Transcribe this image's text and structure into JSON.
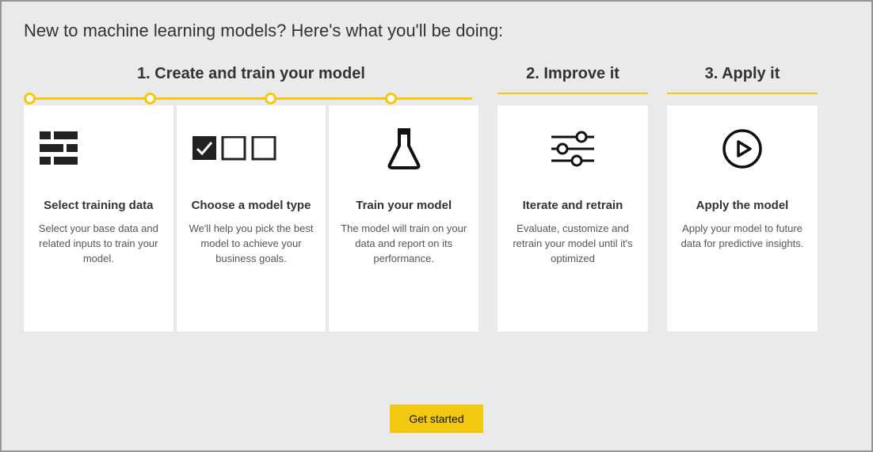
{
  "title": "New to machine learning models? Here's what you'll be doing:",
  "sections": {
    "s1": {
      "title": "1. Create and train your model"
    },
    "s2": {
      "title": "2. Improve it"
    },
    "s3": {
      "title": "3. Apply it"
    }
  },
  "cards": {
    "c1": {
      "title": "Select training data",
      "desc": "Select your base data and related inputs to train your model.",
      "icon": "data-rows-icon"
    },
    "c2": {
      "title": "Choose a model type",
      "desc": "We'll help you pick the best model to achieve your business goals.",
      "icon": "checkbox-options-icon"
    },
    "c3": {
      "title": "Train your model",
      "desc": "The model will train on your data and report on its performance.",
      "icon": "flask-icon"
    },
    "c4": {
      "title": "Iterate and retrain",
      "desc": "Evaluate, customize and retrain your model until it's optimized",
      "icon": "sliders-icon"
    },
    "c5": {
      "title": "Apply the model",
      "desc": "Apply your model to future data for predictive insights.",
      "icon": "play-circle-icon"
    }
  },
  "footer": {
    "button": "Get started"
  },
  "colors": {
    "accent": "#f2c811"
  }
}
